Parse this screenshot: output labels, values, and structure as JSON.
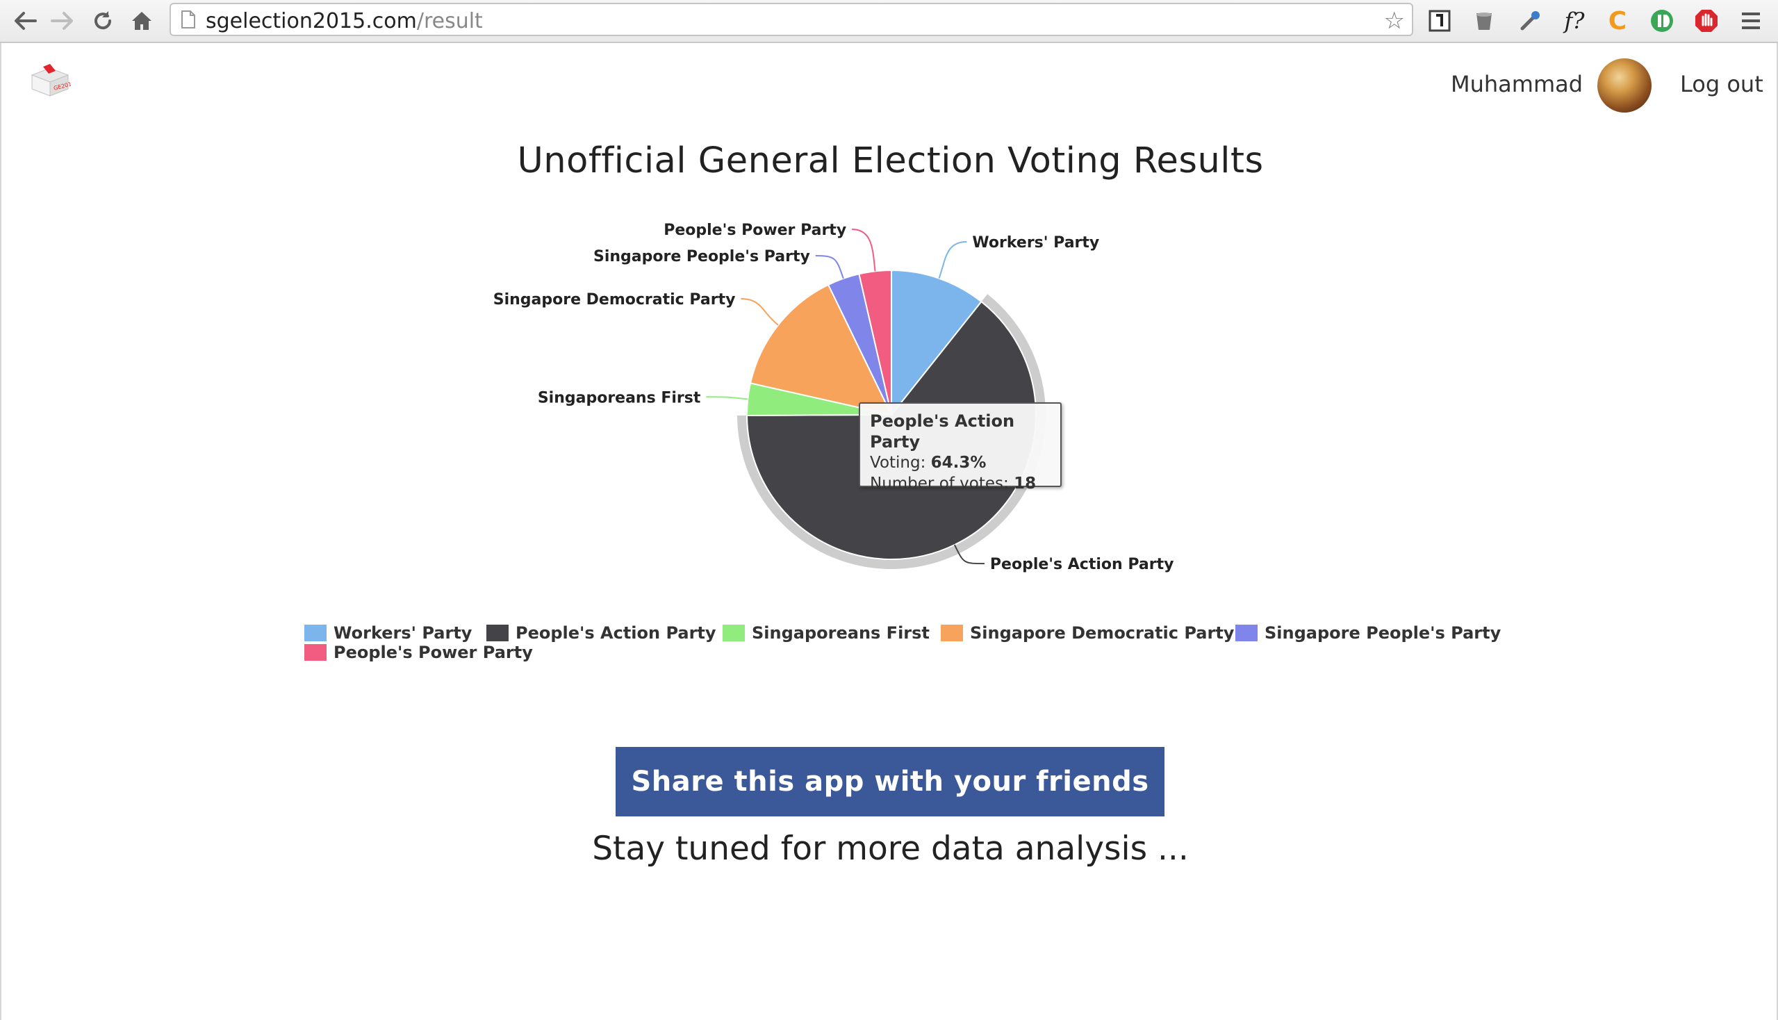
{
  "browser": {
    "url_host": "sgelection2015.com",
    "url_path": "/result",
    "icons": [
      "back-arrow-icon",
      "forward-arrow-icon",
      "reload-icon",
      "home-icon",
      "page-icon",
      "bookmark-star-icon",
      "reader-icon",
      "cup-icon",
      "eyedropper-icon",
      "fx-icon",
      "c-extension-icon",
      "green-toggle-icon",
      "stop-hand-icon",
      "menu-icon"
    ],
    "ext_fx_label": "f?",
    "ext_c_label": "C"
  },
  "header": {
    "user_name": "Muhammad",
    "logout_label": "Log out",
    "logo_text": "GE2015"
  },
  "title": "Unofficial General Election Voting Results",
  "tooltip": {
    "party": "People's Action Party",
    "voting_label": "Voting: ",
    "voting_value": "64.3%",
    "votes_label": "Number of votes: ",
    "votes_value": "18"
  },
  "chart_data": {
    "type": "pie",
    "title": "Unofficial General Election Voting Results",
    "series": [
      {
        "name": "Workers' Party",
        "value": 10.7,
        "color": "#7cb5ec"
      },
      {
        "name": "People's Action Party",
        "value": 64.3,
        "votes": 18,
        "color": "#434348"
      },
      {
        "name": "Singaporeans First",
        "value": 3.6,
        "color": "#90ed7d"
      },
      {
        "name": "Singapore Democratic Party",
        "value": 14.3,
        "color": "#f7a35c"
      },
      {
        "name": "Singapore People's Party",
        "value": 3.6,
        "color": "#8085e9"
      },
      {
        "name": "People's Power Party",
        "value": 3.6,
        "color": "#f15c80"
      }
    ],
    "hovered": "People's Action Party",
    "legend_position": "bottom"
  },
  "legend": [
    "Workers' Party",
    "People's Action Party",
    "Singaporeans First",
    "Singapore Democratic Party",
    "Singapore People's Party",
    "People's Power Party"
  ],
  "share_label": "Share this app with your friends",
  "stay_tuned": "Stay tuned for more data analysis ..."
}
